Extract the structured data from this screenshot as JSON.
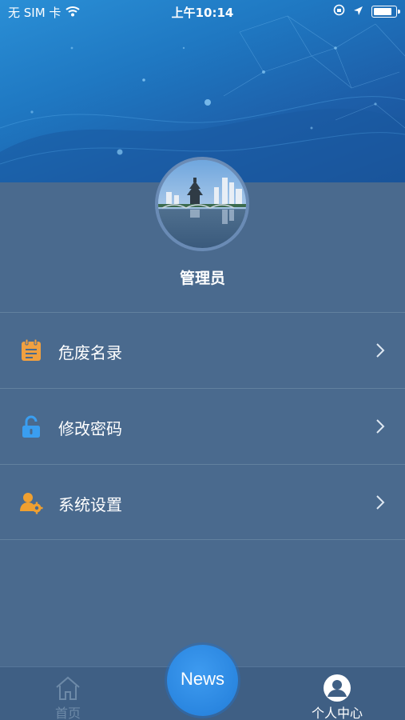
{
  "status_bar": {
    "carrier": "无 SIM 卡",
    "time": "上午10:14",
    "battery_level": 0.85
  },
  "profile": {
    "user_name": "管理员",
    "avatar_alt": "city-skyline-avatar"
  },
  "menu": {
    "items": [
      {
        "label": "危废名录",
        "icon": "clipboard-icon",
        "color": "#f0a040"
      },
      {
        "label": "修改密码",
        "icon": "unlock-icon",
        "color": "#3a9ef0"
      },
      {
        "label": "系统设置",
        "icon": "user-settings-icon",
        "color": "#f0a030"
      }
    ]
  },
  "tab_bar": {
    "home_label": "首页",
    "news_label": "News",
    "me_label": "个人中心"
  },
  "colors": {
    "background": "#4a6a8e",
    "tab_bar": "#3f5f84",
    "news_button": "#2a86e0"
  }
}
